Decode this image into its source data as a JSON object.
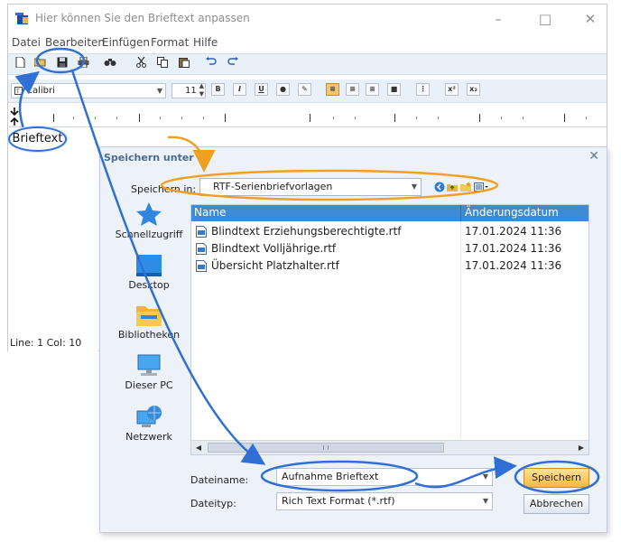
{
  "editor": {
    "title": "Hier können Sie den Brieftext anpassen",
    "menu": [
      "Datei",
      "Bearbeiten",
      "Einfügen",
      "Format",
      "Hilfe"
    ],
    "font_name": "Calibri",
    "font_size": "11",
    "status_line": "Line:  1  Col:  10"
  },
  "annotation": {
    "label": "Brieftext",
    "accent_color": "#2f6fd6",
    "highlight_color": "#f0a020"
  },
  "dialog": {
    "title": "Speichern unter",
    "save_in_label": "Speichern in:",
    "folder": "RTF-Serienbriefvorlagen",
    "places": [
      "Schnellzugriff",
      "Desktop",
      "Bibliotheken",
      "Dieser PC",
      "Netzwerk"
    ],
    "columns": {
      "name": "Name",
      "date": "Änderungsdatum"
    },
    "files": [
      {
        "name": "Blindtext Erziehungsberechtigte.rtf",
        "date": "17.01.2024 11:36"
      },
      {
        "name": "Blindtext Volljährige.rtf",
        "date": "17.01.2024 11:36"
      },
      {
        "name": "Übersicht Platzhalter.rtf",
        "date": "17.01.2024 11:36"
      }
    ],
    "filename_label": "Dateiname:",
    "filename_value": "Aufnahme Brieftext",
    "filetype_label": "Dateityp:",
    "filetype_value": "Rich Text Format (*.rtf)",
    "save_button": "Speichern",
    "cancel_button": "Abbrechen"
  }
}
